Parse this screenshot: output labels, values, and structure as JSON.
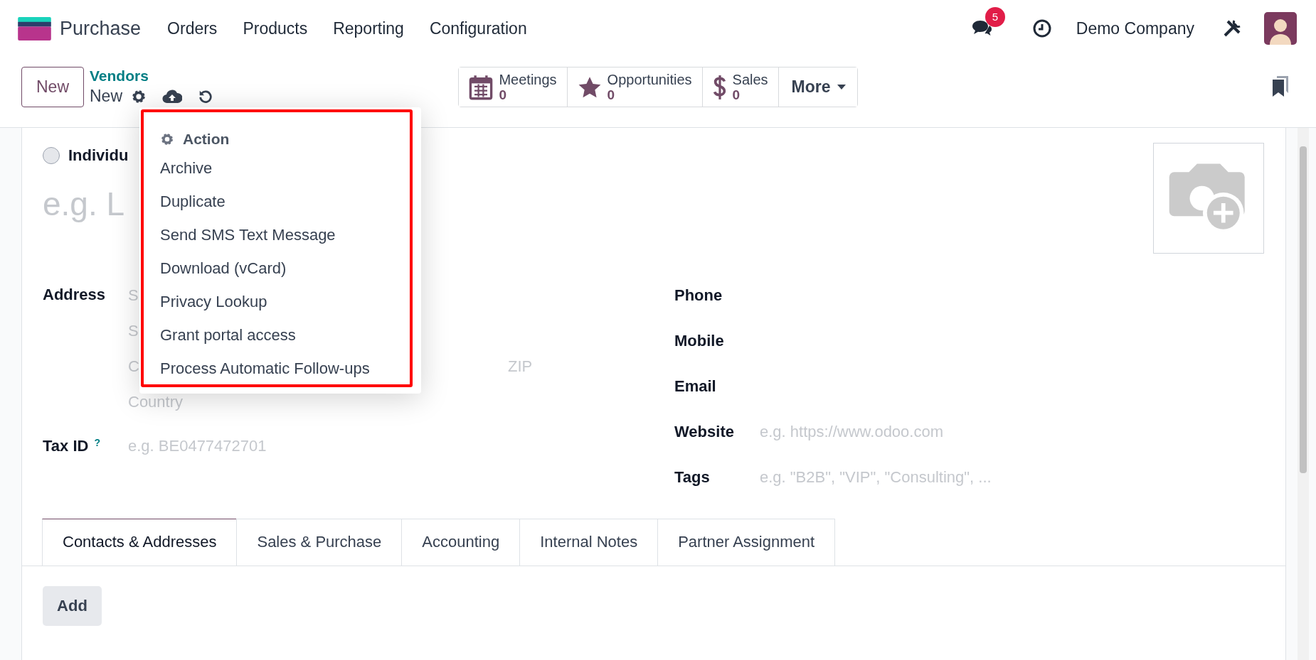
{
  "navbar": {
    "app_name": "Purchase",
    "menu": [
      "Orders",
      "Products",
      "Reporting",
      "Configuration"
    ],
    "messages_badge": "5",
    "company": "Demo Company"
  },
  "control_panel": {
    "new_button": "New",
    "breadcrumb": "Vendors",
    "record_title": "New",
    "smart_buttons": [
      {
        "kind": "calendar",
        "label": "Meetings",
        "value": "0"
      },
      {
        "kind": "star",
        "label": "Opportunities",
        "value": "0"
      },
      {
        "kind": "dollar",
        "label": "Sales",
        "value": "0"
      }
    ],
    "more_button": "More"
  },
  "action_menu": {
    "header": "Action",
    "items": [
      "Archive",
      "Duplicate",
      "Send SMS Text Message",
      "Download (vCard)",
      "Privacy Lookup",
      "Grant portal access",
      "Process Automatic Follow-ups"
    ]
  },
  "form": {
    "company_type": {
      "label": "Individu",
      "selected": false
    },
    "name_placeholder": "e.g. L",
    "address": {
      "label": "Address",
      "street_placeholder": "S",
      "street2_placeholder": "S",
      "city_placeholder": "C",
      "zip_placeholder": "ZIP",
      "country_placeholder": "Country"
    },
    "tax_id": {
      "label": "Tax ID",
      "help": "?",
      "placeholder": "e.g. BE0477472701"
    },
    "contact_fields": [
      {
        "label": "Phone"
      },
      {
        "label": "Mobile"
      },
      {
        "label": "Email"
      },
      {
        "label": "Website",
        "placeholder": "e.g. https://www.odoo.com"
      },
      {
        "label": "Tags",
        "placeholder": "e.g. \"B2B\", \"VIP\", \"Consulting\", ..."
      }
    ]
  },
  "notebook": {
    "tabs": [
      {
        "label": "Contacts & Addresses",
        "selected": true
      },
      {
        "label": "Sales & Purchase",
        "selected": false
      },
      {
        "label": "Accounting",
        "selected": false
      },
      {
        "label": "Internal Notes",
        "selected": false
      },
      {
        "label": "Partner Assignment",
        "selected": false
      }
    ],
    "add_button": "Add"
  }
}
